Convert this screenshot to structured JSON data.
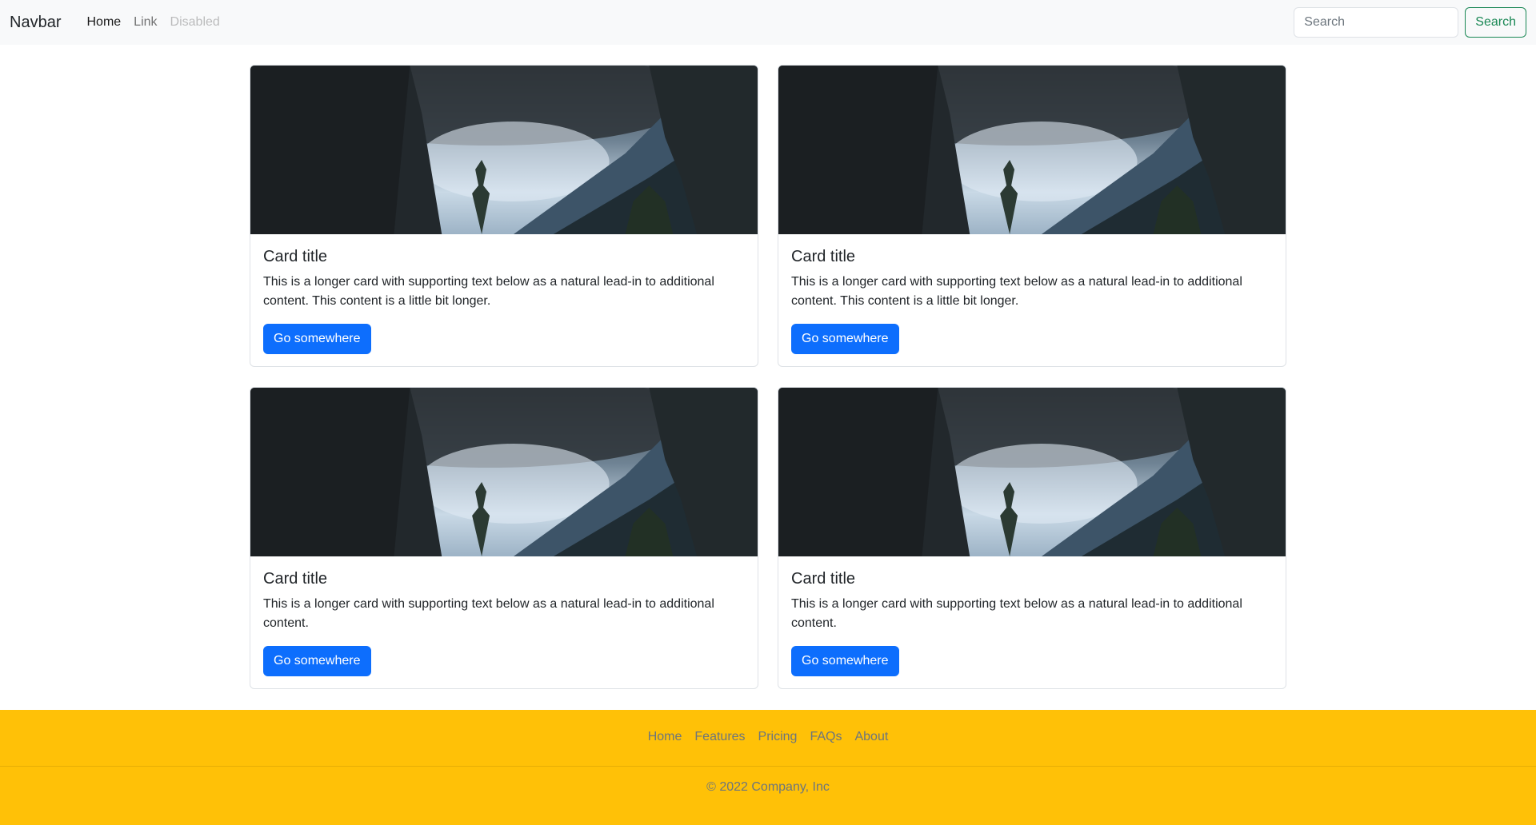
{
  "navbar": {
    "brand": "Navbar",
    "links": [
      {
        "label": "Home",
        "state": "active"
      },
      {
        "label": "Link",
        "state": "normal"
      },
      {
        "label": "Disabled",
        "state": "disabled"
      }
    ],
    "search": {
      "placeholder": "Search",
      "value": "",
      "button_label": "Search"
    }
  },
  "cards": [
    {
      "title": "Card title",
      "text": "This is a longer card with supporting text below as a natural lead-in to additional content. This content is a little bit longer.",
      "button_label": "Go somewhere"
    },
    {
      "title": "Card title",
      "text": "This is a longer card with supporting text below as a natural lead-in to additional content. This content is a little bit longer.",
      "button_label": "Go somewhere"
    },
    {
      "title": "Card title",
      "text": "This is a longer card with supporting text below as a natural lead-in to additional content.",
      "button_label": "Go somewhere"
    },
    {
      "title": "Card title",
      "text": "This is a longer card with supporting text below as a natural lead-in to additional content.",
      "button_label": "Go somewhere"
    }
  ],
  "footer": {
    "links": [
      "Home",
      "Features",
      "Pricing",
      "FAQs",
      "About"
    ],
    "copyright": "© 2022 Company, Inc"
  },
  "colors": {
    "navbar_bg": "#f8f9fa",
    "primary": "#0d6efd",
    "success": "#198754",
    "footer_bg": "#ffc107"
  }
}
